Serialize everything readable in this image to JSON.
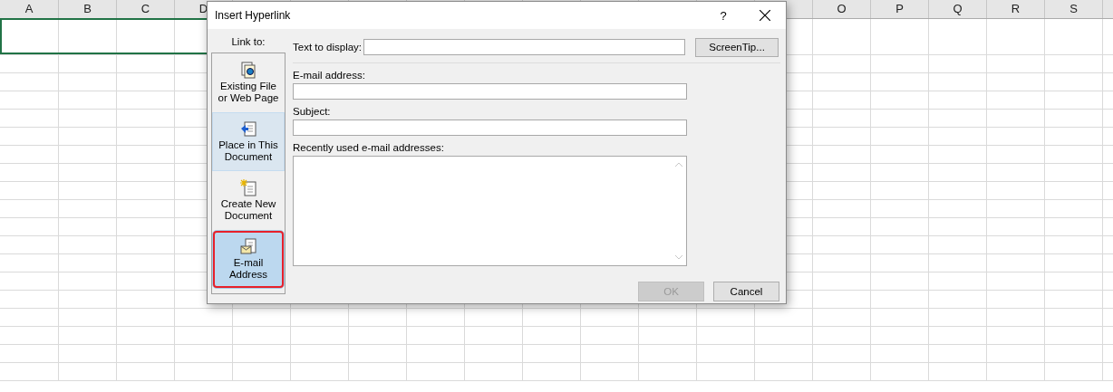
{
  "sheet": {
    "columns_left": [
      "A",
      "B",
      "C",
      "D"
    ],
    "columns_right": [
      "O",
      "P",
      "Q",
      "R",
      "S"
    ]
  },
  "dialog": {
    "title": "Insert Hyperlink",
    "help": "?",
    "link_to": {
      "label": "Link to:",
      "items": [
        {
          "kind": "file",
          "label": "Existing File or Web Page",
          "selected": false,
          "hovered": false,
          "annotated": false
        },
        {
          "kind": "place",
          "label": "Place in This Document",
          "selected": false,
          "hovered": true,
          "annotated": false
        },
        {
          "kind": "new",
          "label": "Create New Document",
          "selected": false,
          "hovered": false,
          "annotated": false
        },
        {
          "kind": "email",
          "label": "E-mail Address",
          "selected": true,
          "hovered": false,
          "annotated": true
        }
      ]
    },
    "text_to_display": {
      "label": "Text to display:"
    },
    "screentip_button": "ScreenTip...",
    "email_address": {
      "label": "E-mail address:"
    },
    "subject": {
      "label": "Subject:"
    },
    "recent": {
      "label": "Recently used e-mail addresses:"
    },
    "buttons": [
      {
        "label": "OK",
        "disabled": true
      },
      {
        "label": "Cancel",
        "disabled": false
      }
    ]
  }
}
